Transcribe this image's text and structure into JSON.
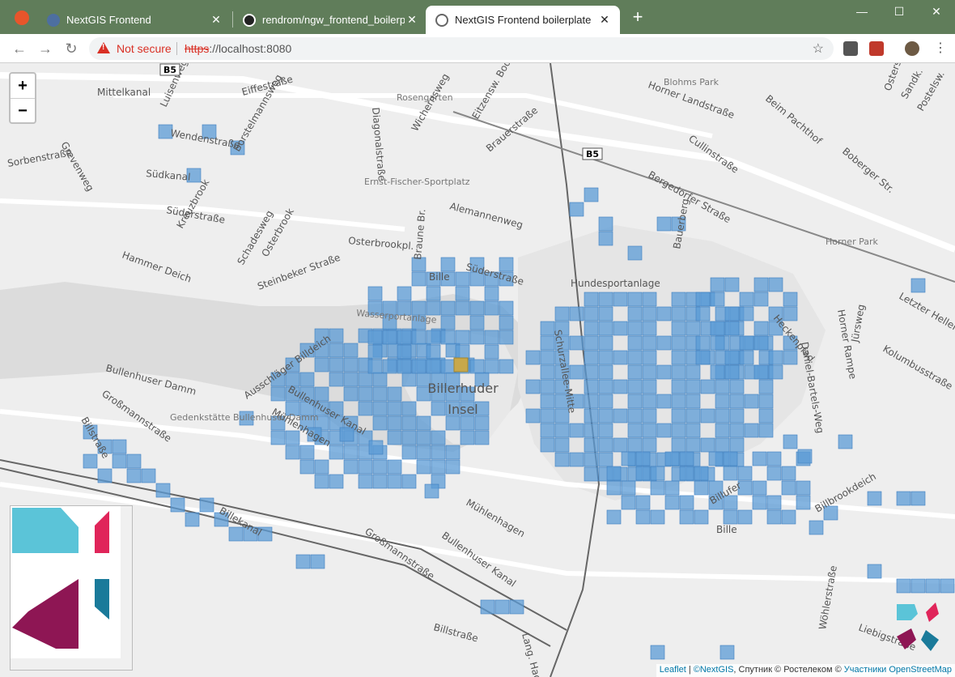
{
  "browser": {
    "tabs": [
      {
        "title": "NextGIS Frontend",
        "icon": "nextgis-favicon-icon",
        "active": false
      },
      {
        "title": "rendrom/ngw_frontend_boilerpla",
        "icon": "github-icon",
        "active": false
      },
      {
        "title": "NextGIS Frontend boilerplate",
        "icon": "globe-icon",
        "active": true
      }
    ],
    "security_label": "Not secure",
    "url_protocol": "https",
    "url_rest": "://localhost:8080"
  },
  "map": {
    "zoom_in": "+",
    "zoom_out": "−",
    "island_label_line1": "Billerhuder",
    "island_label_line2": "Insel",
    "street_labels": [
      "Mittelkanal",
      "Eiffestraße",
      "Wendenstraße",
      "Sorbenstraße",
      "Grevenweg",
      "Luisenweg",
      "Borstelmannsweg",
      "Südkanal",
      "Süderstraße",
      "Kreuzbrook",
      "Hammer Deich",
      "Schadesweg",
      "Osterbrook",
      "Steinbeker Straße",
      "Osterbrookpl.",
      "Diagonalstraße",
      "Alemannenweg",
      "Braune Br.",
      "Süderstraße",
      "Bille",
      "Bergedorfer Straße",
      "Cullinstraße",
      "Horner Landstraße",
      "Hundesportanlage",
      "Schurzallee-Mitte",
      "Heckenpfad",
      "Daniel-Bartels-Weg",
      "Horner Rampe",
      "Jürsweg",
      "Kolumbusstraße",
      "Letzter Heller",
      "Bullenhuser Damm",
      "Großmannstraße",
      "Ausschläger Billdeich",
      "Bullenhuser Kanal",
      "Mühlenhagen",
      "Billstraße",
      "Billekanal",
      "Mühlenhagen",
      "Großmannstraße",
      "Bullenhuser Kanal",
      "Billstraße",
      "Billufer",
      "Bille",
      "Billbrookdeich",
      "Wöhlerstraße",
      "Liebigstraße",
      "Lang. Hagen",
      "Bauerberg",
      "Wasserportanlage",
      "Ernst-Fischer-Sportplatz",
      "Horner Park",
      "Blohms Park",
      "Rosengarten",
      "Gedenkstätte Bullenhuser Damm",
      "Beim Pachthof",
      "Boberger Str.",
      "Wichernsweg",
      "Eitzensw. Boomhof",
      "Brauerstraße",
      "Ostersw.",
      "Sandk.",
      "Postelsw.",
      "Bonnelburgw."
    ],
    "road_shields": [
      "B5",
      "B5"
    ],
    "layers": {
      "grid_color": "#5b9bd5",
      "highlight_color": "#c8a84b"
    }
  },
  "legend": {
    "logo": "nextgis-logo-icon"
  },
  "attribution": {
    "leaflet": "Leaflet",
    "sep": "|",
    "nextgis": "©NextGIS",
    "middle": ", Спутник © Ростелеком © ",
    "osm": "Участники OpenStreetMap"
  }
}
